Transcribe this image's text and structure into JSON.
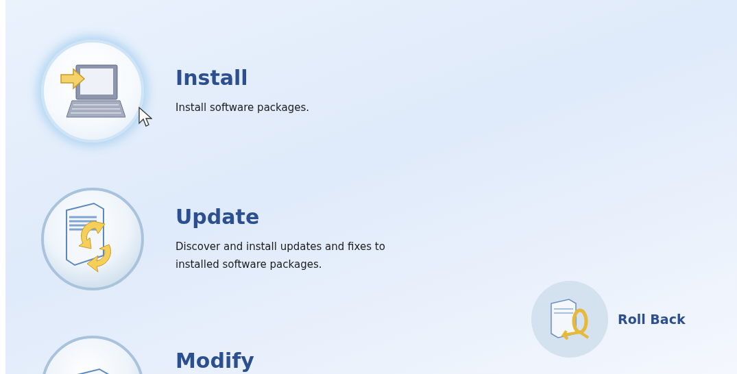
{
  "actions": [
    {
      "kind": "install",
      "title": "Install",
      "description": "Install software packages.",
      "highlighted": true
    },
    {
      "kind": "update",
      "title": "Update",
      "description": "Discover and install updates and fixes to installed software packages.",
      "highlighted": false
    },
    {
      "kind": "modify",
      "title": "Modify",
      "highlighted": false
    }
  ],
  "secondary_action": {
    "kind": "rollback",
    "title": "Roll Back"
  }
}
